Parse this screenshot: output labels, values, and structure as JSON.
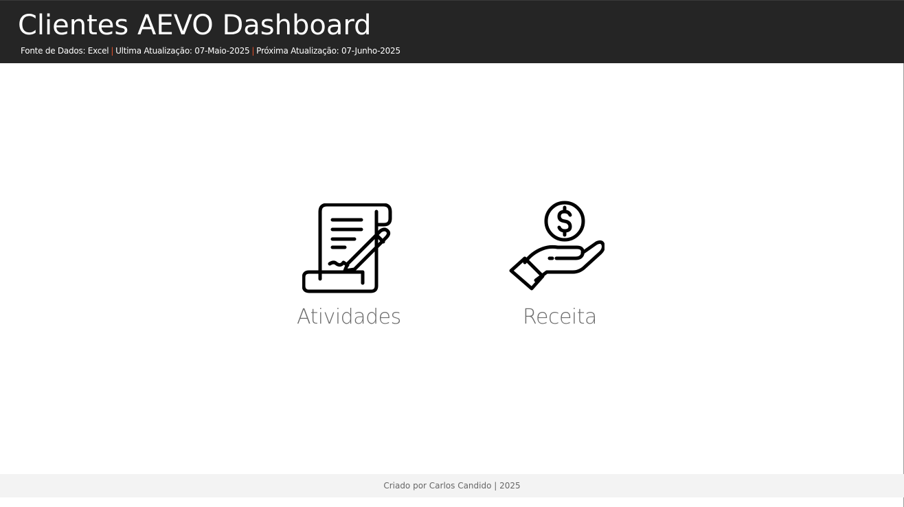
{
  "header": {
    "title": "Clientes AEVO Dashboard",
    "source": "Fonte de Dados: Excel",
    "separator": "|",
    "last_update": "Ultima Atualização: 07-Maio-2025",
    "next_update": "Próxima Atualização: 07-Junho-2025",
    "background_color": "#252525",
    "separator_color": "#e8532c"
  },
  "navigation": {
    "items": [
      {
        "label": "Atividades",
        "icon": "contract-scroll-pen-icon"
      },
      {
        "label": "Receita",
        "icon": "hand-dollar-coin-icon"
      }
    ]
  },
  "footer": {
    "text": "Criado por Carlos Candido | 2025"
  }
}
